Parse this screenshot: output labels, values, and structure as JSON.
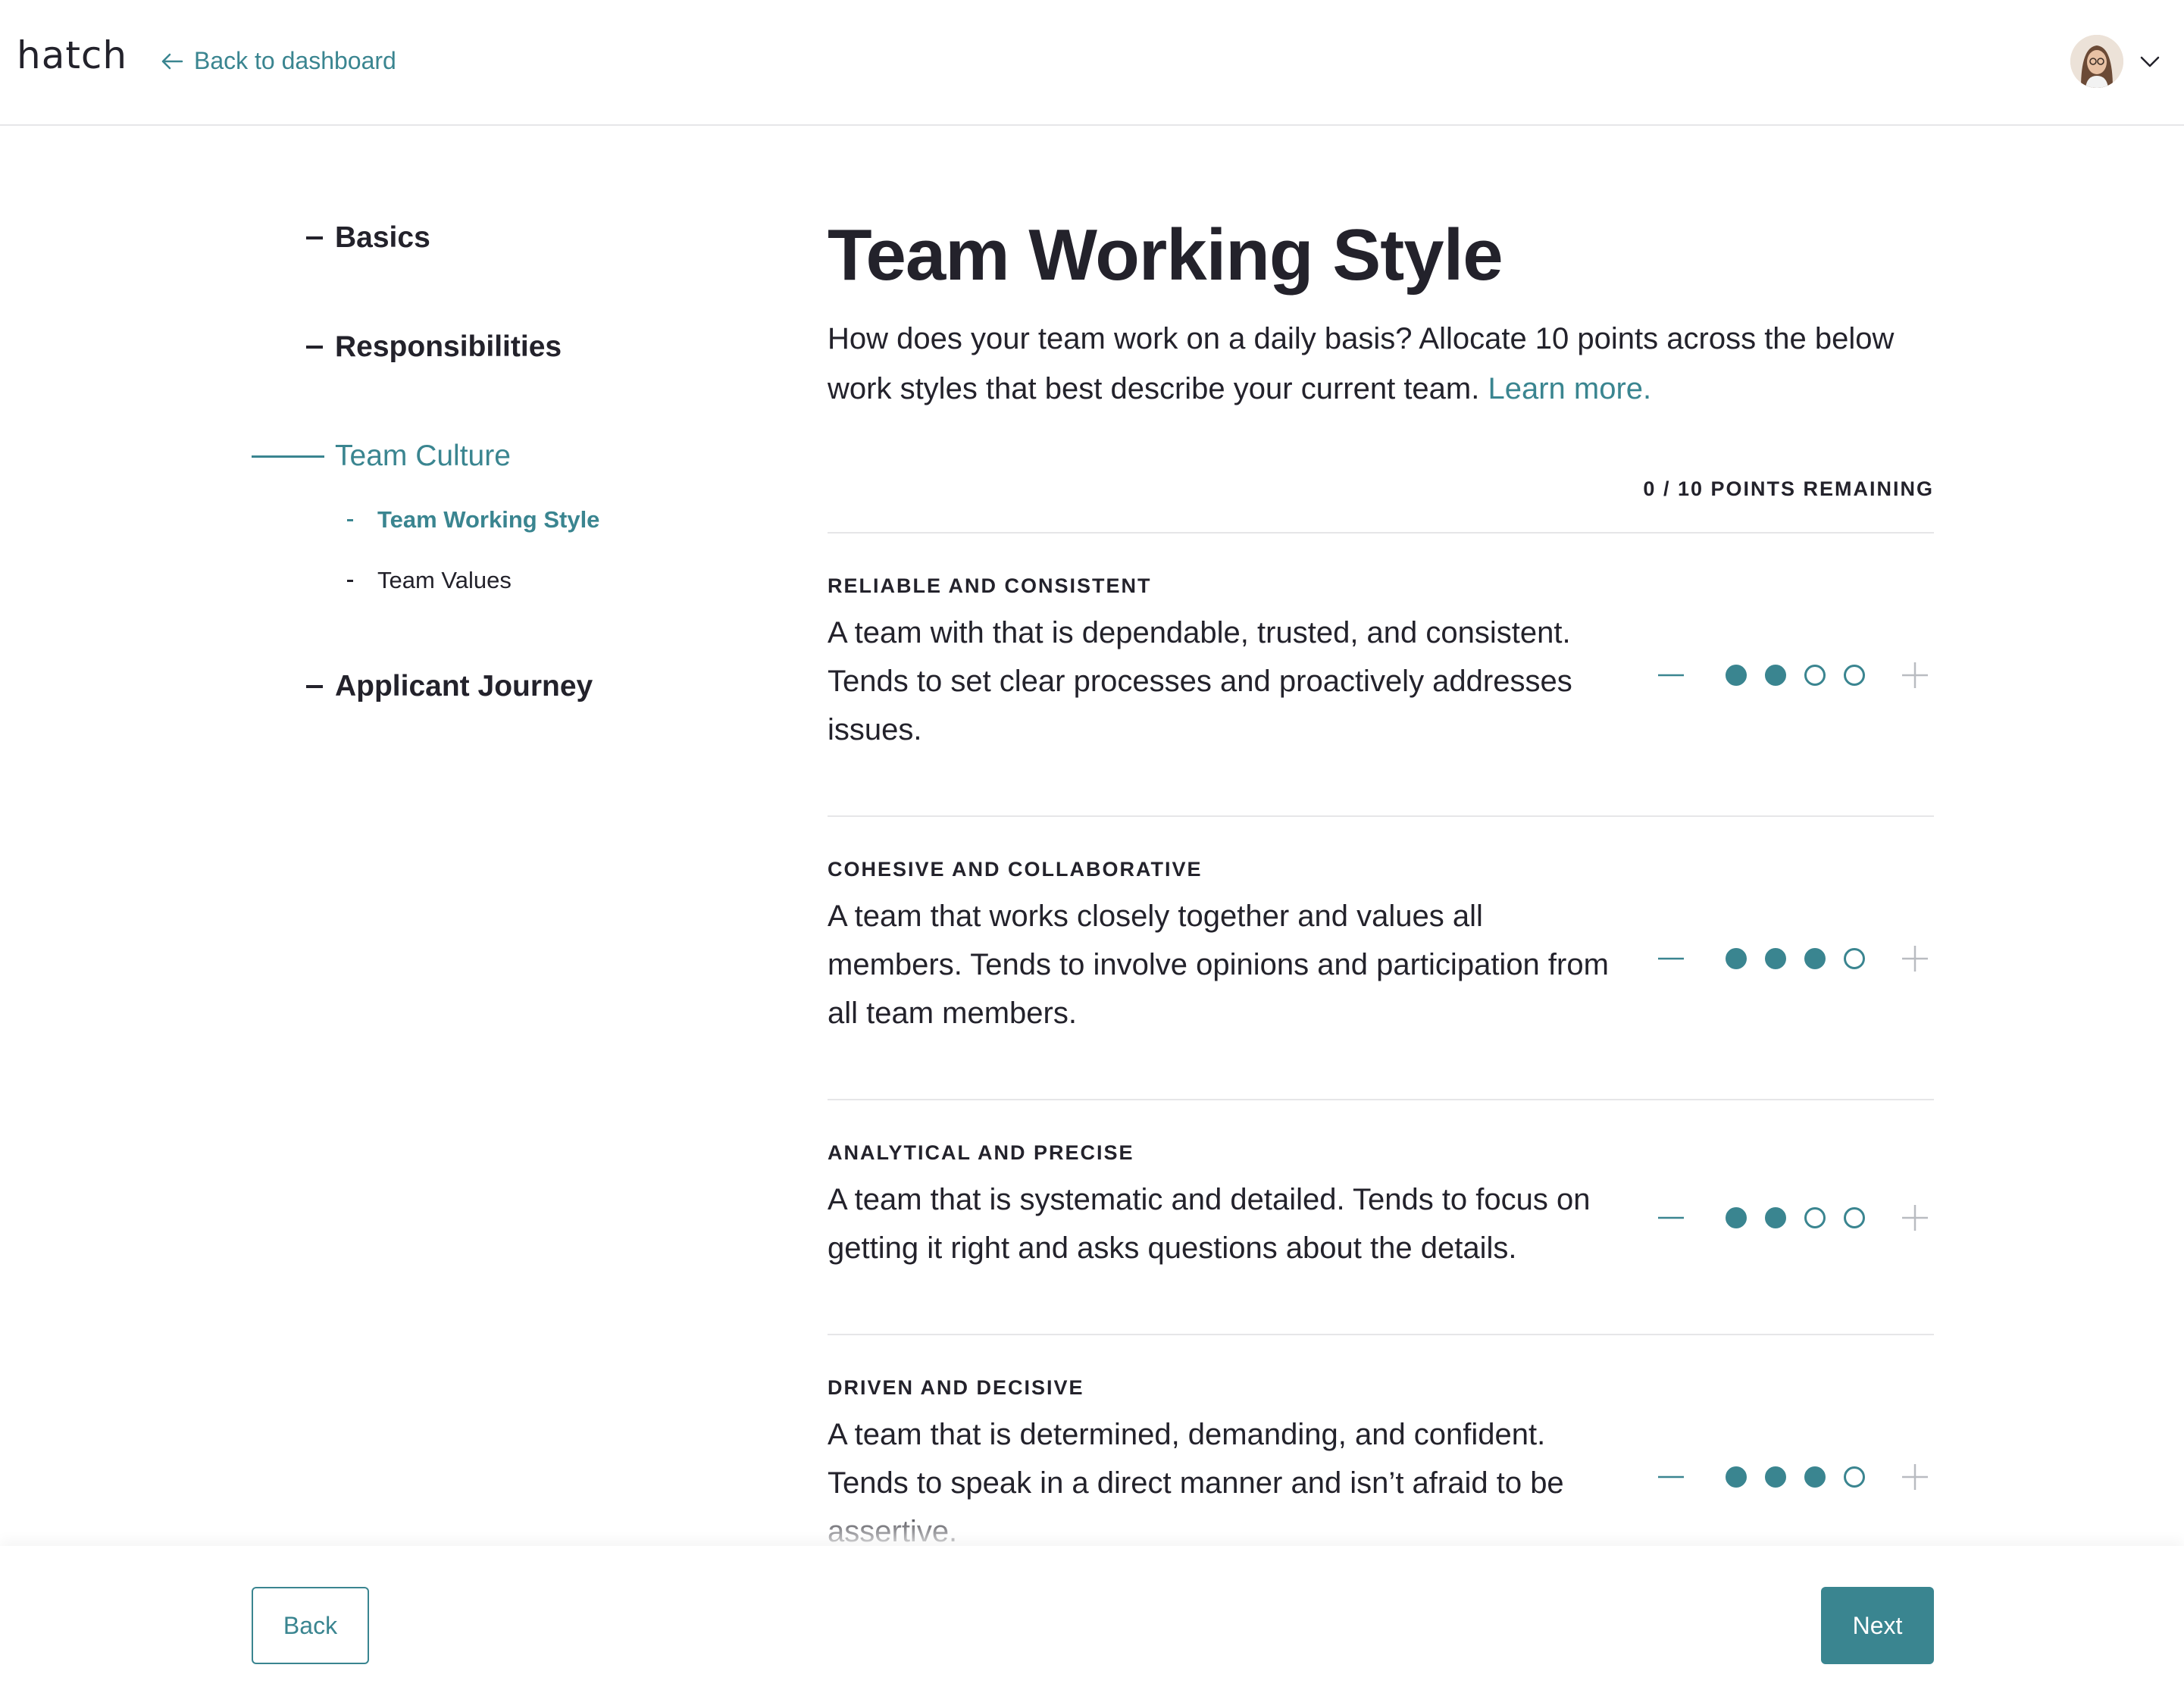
{
  "header": {
    "logo": "hatch",
    "back_label": "Back to dashboard"
  },
  "sidebar": {
    "items": [
      {
        "label": "Basics"
      },
      {
        "label": "Responsibilities"
      },
      {
        "label": "Team Culture"
      },
      {
        "label": "Applicant Journey"
      }
    ],
    "sub_items": [
      {
        "label": "Team Working Style"
      },
      {
        "label": "Team Values"
      }
    ]
  },
  "main": {
    "title": "Team Working Style",
    "intro": "How does your team work on a daily basis? Allocate 10 points across the below work styles that best describe your current team.",
    "learn_more": "Learn more.",
    "points_remaining": "0 / 10 POINTS REMAINING",
    "styles": [
      {
        "category": "RELIABLE AND CONSISTENT",
        "description": "A team with that is dependable, trusted, and consistent. Tends to set clear processes and proactively addresses issues.",
        "points": 2,
        "max": 4
      },
      {
        "category": "COHESIVE AND COLLABORATIVE",
        "description": "A team that works closely together and values all members. Tends to involve opinions and participation from all team members.",
        "points": 3,
        "max": 4
      },
      {
        "category": "ANALYTICAL AND PRECISE",
        "description": "A team that is systematic and detailed. Tends to focus on getting it right and asks questions about the details.",
        "points": 2,
        "max": 4
      },
      {
        "category": "DRIVEN AND DECISIVE",
        "description": "A team that is determined, demanding, and confident. Tends to speak in a direct manner and isn’t afraid to be assertive.",
        "points": 3,
        "max": 4
      }
    ]
  },
  "footer": {
    "back_label": "Back",
    "next_label": "Next"
  },
  "colors": {
    "accent": "#3a8590",
    "text": "#23222b",
    "divider": "#e6e6e8"
  }
}
